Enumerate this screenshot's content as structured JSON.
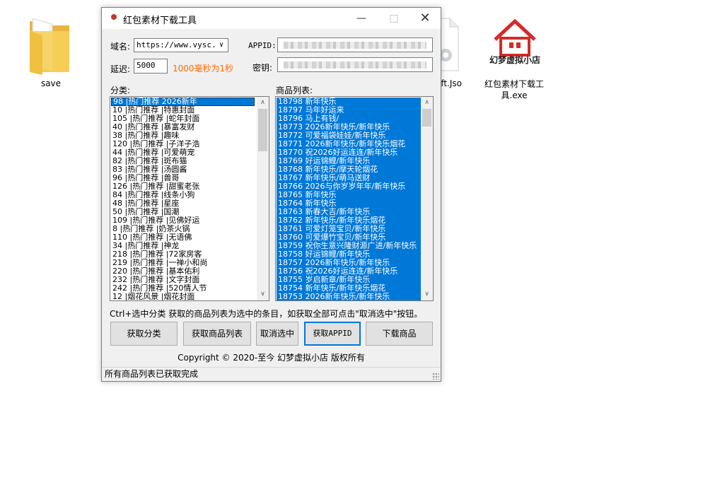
{
  "desktop": {
    "icons": [
      {
        "label": "save"
      },
      {
        "label": "oft.Jso\nl"
      },
      {
        "label": "红包素材下载工具.exe"
      }
    ],
    "house_logo_text": "幻梦虚拟小店"
  },
  "window": {
    "title": "红包素材下载工具",
    "domain_label": "域名:",
    "domain_value": "https://www.vysc.vi",
    "appid_label": "APPID:",
    "delay_label": "延迟:",
    "delay_value": "5000",
    "delay_hint": "1000毫秒为1秒",
    "secret_label": "密钥:",
    "category_label": "分类:",
    "product_label": "商品列表:",
    "categories": [
      "98 |热门推荐 2026新年",
      "10 |热门推荐 |特惠封面",
      "105 |热门推荐 |蛇年封面",
      "40 |热门推荐 |暴富发财",
      "38 |热门推荐 |趣味",
      "120 |热门推荐 |子洋子浩",
      "44 |热门推荐 |可爱萌宠",
      "82 |热门推荐 |斑布猫",
      "83 |热门推荐 |汤圆酱",
      "96 |热门推荐 |兽哥",
      "126 |热门推荐 |甜蜜老张",
      "84 |热门推荐 |线条小狗",
      "48 |热门推荐 |星座",
      "50 |热门推荐 |国潮",
      "109 |热门推荐 |见佛好运",
      "8 |热门推荐 |奶茶火锅",
      "110 |热门推荐 |无语佛",
      "34 |热门推荐 |神龙",
      "218 |热门推荐 |72家房客",
      "219 |热门推荐 |一禅小和尚",
      "220 |热门推荐 |基本佑利",
      "232 |热门推荐 |文字封面",
      "242 |热门推荐 |520情人节",
      "12 |烟花风景 |烟花封面"
    ],
    "products": [
      "18798 新年快乐",
      "18797 马年好运来",
      "18796 马上有钱/",
      "18773 2026新年快乐/新年快乐",
      "18772 可爱福袋娃娃/新年快乐",
      "18771 2026新年快乐/新年快乐烟花",
      "18770  祝2026好运连连/新年快乐",
      "18769 好运锦鲤/新年快乐",
      "18768 新年快乐/摩天轮烟花",
      "18767 新年快乐/萌马送财",
      "18766 2026与你岁岁年年/新年快乐",
      "18765 新年快乐",
      "18764 新年快乐",
      "18763 新春大吉/新年快乐",
      "18762 新年快乐/新年快乐烟花",
      "18761 可爱灯笼宝贝/新年快乐",
      "18760 可爱爆竹宝贝/新年快乐",
      "18759 祝你生意兴隆财源广进/新年快乐",
      "18758 好运锦鲤/新年快乐",
      "18757 2026新年快乐/新年快乐",
      "18756 祝2026好运连连/新年快乐",
      "18755 岁启新章/新年快乐",
      "18754 新年快乐/新年快乐烟花",
      "18753 2026新年快乐/新年快乐"
    ],
    "info_text": "Ctrl+选中分类 获取的商品列表为选中的条目，如获取全部可点击\"取消选中\"按钮。",
    "buttons": {
      "get_categories": "获取分类",
      "get_products": "获取商品列表",
      "deselect": "取消选中",
      "get_appid": "获取APPID",
      "download": "下载商品"
    },
    "copyright": "Copyright © 2020-至今 幻梦虚拟小店 版权所有",
    "status": "所有商品列表已获取完成"
  },
  "colors": {
    "selection": "#0078d7",
    "hint": "#ff6a00",
    "window_bg": "#f0f0f0"
  }
}
